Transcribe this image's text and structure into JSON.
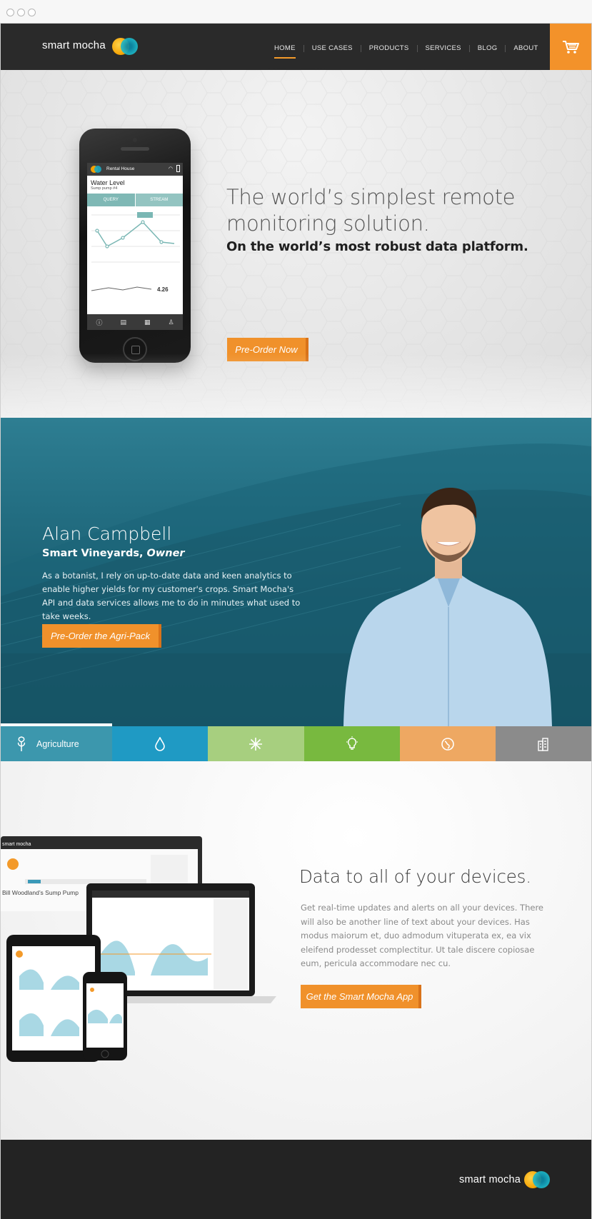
{
  "nav": {
    "brand": "smart mocha",
    "links": [
      "HOME",
      "USE CASES",
      "PRODUCTS",
      "SERVICES",
      "BLOG",
      "ABOUT"
    ],
    "active": "HOME",
    "cart_icon": "shopping-cart-icon"
  },
  "hero": {
    "headline": "The world’s simplest remote monitoring solution.",
    "subheadline": "On the world’s most robust data platform.",
    "cta": "Pre-Order Now",
    "phone": {
      "header": "Rental House",
      "metric_title": "Water Level",
      "metric_sub": "Sump pump #4",
      "tabs": [
        "QUERY",
        "STREAM"
      ],
      "reading": "4.26"
    }
  },
  "testimonial": {
    "name": "Alan Campbell",
    "company": "Smart Vineyards,",
    "role": "Owner",
    "quote": "As a botanist, I rely on up-to-date data and keen analytics to enable higher yields for my customer's crops. Smart Mocha's API and data services allows me to do in minutes what used to take weeks.",
    "cta": "Pre-Order the Agri-Pack"
  },
  "categories": [
    {
      "label": "Agriculture",
      "icon": "plant-icon",
      "color": "#3c97ad"
    },
    {
      "label": "",
      "icon": "water-drop-icon",
      "color": "#1f9ac4"
    },
    {
      "label": "",
      "icon": "snowflake-icon",
      "color": "#a7cf7f"
    },
    {
      "label": "",
      "icon": "light-bulb-icon",
      "color": "#78b93f"
    },
    {
      "label": "",
      "icon": "globe-icon",
      "color": "#eea862"
    },
    {
      "label": "",
      "icon": "building-icon",
      "color": "#8b8b8b"
    }
  ],
  "devices": {
    "headline": "Data to all of your devices.",
    "body": "Get real-time updates and alerts on all your devices. There will also be another line of text about your devices. Has modus maiorum et, duo admodum vituperata ex, ea vix eleifend prodesset complectitur. Ut tale discere copiosae eum, pericula accommodare nec cu.",
    "cta": "Get the Smart Mocha App",
    "screen_title": "Bill Woodland’s Sump Pump"
  },
  "footer": {
    "brand": "smart mocha"
  },
  "colors": {
    "accent": "#f0912b",
    "nav_bg": "#2a2a2a",
    "teal": "#236e82"
  }
}
